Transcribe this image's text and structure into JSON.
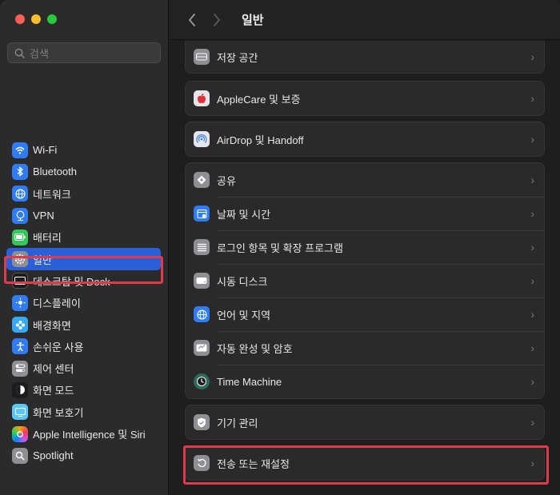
{
  "window": {
    "title": "일반"
  },
  "sidebar": {
    "search_placeholder": "검색",
    "items": [
      {
        "label": "Wi-Fi",
        "icon": "wifi-icon",
        "color": "#2f7cf6"
      },
      {
        "label": "Bluetooth",
        "icon": "bluetooth-icon",
        "color": "#2f7cf6"
      },
      {
        "label": "네트워크",
        "icon": "globe-icon",
        "color": "#2f7cf6"
      },
      {
        "label": "VPN",
        "icon": "vpn-globe-icon",
        "color": "#2f7cf6"
      },
      {
        "label": "배터리",
        "icon": "battery-icon",
        "color": "#34c759"
      },
      {
        "label": "일반",
        "icon": "gear-icon",
        "color": "#8e8e93",
        "selected": true
      },
      {
        "label": "데스크탑 및 Dock",
        "icon": "dock-icon",
        "color": "#1c1c1e"
      },
      {
        "label": "디스플레이",
        "icon": "display-icon",
        "color": "#2f7cf6"
      },
      {
        "label": "배경화면",
        "icon": "wallpaper-icon",
        "color": "#35aaf2"
      },
      {
        "label": "손쉬운 사용",
        "icon": "accessibility-icon",
        "color": "#2f7cf6"
      },
      {
        "label": "제어 센터",
        "icon": "control-center-icon",
        "color": "#8e8e93"
      },
      {
        "label": "화면 모드",
        "icon": "appearance-icon",
        "color": "#1c1c1e"
      },
      {
        "label": "화면 보호기",
        "icon": "screensaver-icon",
        "color": "#5ac8fa"
      },
      {
        "label": "Apple Intelligence 및 Siri",
        "icon": "siri-icon",
        "color": "#c04bd9"
      },
      {
        "label": "Spotlight",
        "icon": "magnifier-icon",
        "color": "#8e8e93"
      }
    ]
  },
  "toolbar": {
    "back": "‹",
    "forward": "›",
    "title": "일반"
  },
  "content": {
    "group1": [
      {
        "label": "저장 공간",
        "icon": "storage-icon",
        "color": "#8e8e93"
      }
    ],
    "group2": [
      {
        "label": "AppleCare 및 보증",
        "icon": "apple-logo-icon",
        "color": "#e5e5ea"
      }
    ],
    "group3": [
      {
        "label": "AirDrop 및 Handoff",
        "icon": "airdrop-icon",
        "color": "#e5e5ea"
      }
    ],
    "group4": [
      {
        "label": "공유",
        "icon": "sharing-icon",
        "color": "#8e8e93"
      },
      {
        "label": "날짜 및 시간",
        "icon": "calendar-clock-icon",
        "color": "#2f7cf6"
      },
      {
        "label": "로그인 항목 및 확장 프로그램",
        "icon": "list-icon",
        "color": "#8e8e93"
      },
      {
        "label": "시동 디스크",
        "icon": "disk-icon",
        "color": "#8e8e93"
      },
      {
        "label": "언어 및 지역",
        "icon": "globe-icon",
        "color": "#2f7cf6"
      },
      {
        "label": "자동 완성 및 암호",
        "icon": "keyboard-icon",
        "color": "#8e8e93"
      },
      {
        "label": "Time Machine",
        "icon": "time-machine-icon",
        "color": "#2e6a5a"
      }
    ],
    "group5": [
      {
        "label": "기기 관리",
        "icon": "device-management-icon",
        "color": "#8e8e93"
      }
    ],
    "group6": [
      {
        "label": "전송 또는 재설정",
        "icon": "reset-icon",
        "color": "#8e8e93"
      }
    ]
  }
}
